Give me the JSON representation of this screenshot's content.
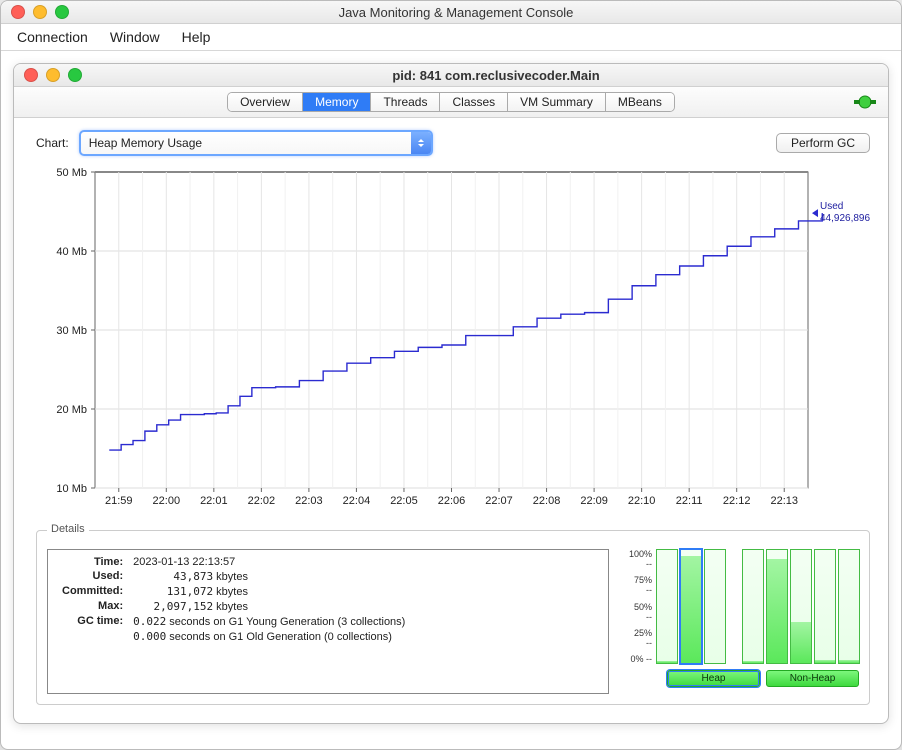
{
  "app_title": "Java Monitoring & Management Console",
  "menubar": [
    "Connection",
    "Window",
    "Help"
  ],
  "inner_title": "pid: 841 com.reclusivecoder.Main",
  "tabs": [
    "Overview",
    "Memory",
    "Threads",
    "Classes",
    "VM Summary",
    "MBeans"
  ],
  "active_tab": "Memory",
  "chart_label": "Chart:",
  "chart_select": "Heap Memory Usage",
  "perform_gc": "Perform GC",
  "used_legend_label": "Used",
  "used_legend_value": "44,926,896",
  "details_legend": "Details",
  "details": {
    "time_label": "Time:",
    "time_value": "2023-01-13 22:13:57",
    "used_label": "Used:",
    "used_value": "43,873",
    "used_unit": "kbytes",
    "committed_label": "Committed:",
    "committed_value": "131,072",
    "committed_unit": "kbytes",
    "max_label": "Max:",
    "max_value": "2,097,152",
    "max_unit": "kbytes",
    "gc_label": "GC time:",
    "gc_line1_num": "0.022",
    "gc_line1_rest": "seconds on G1 Young Generation (3 collections)",
    "gc_line2_num": "0.000",
    "gc_line2_rest": "seconds on G1 Old Generation (0 collections)"
  },
  "bar_pcts": [
    "100% --",
    "75% --",
    "50% --",
    "25% --",
    "0% --"
  ],
  "heap_btn": "Heap",
  "nonheap_btn": "Non-Heap",
  "chart_data": {
    "type": "line",
    "title": "Heap Memory Usage",
    "xlabel": "",
    "ylabel": "Mb",
    "ylim": [
      10,
      50
    ],
    "y_ticks": [
      10,
      20,
      30,
      40,
      50
    ],
    "y_tick_labels": [
      "10 Mb",
      "20 Mb",
      "30 Mb",
      "40 Mb",
      "50 Mb"
    ],
    "x_ticks": [
      "21:59",
      "22:00",
      "22:01",
      "22:02",
      "22:03",
      "22:04",
      "22:05",
      "22:06",
      "22:07",
      "22:08",
      "22:09",
      "22:10",
      "22:11",
      "22:12",
      "22:13"
    ],
    "series": [
      {
        "name": "Used",
        "color": "#2b2bd0",
        "x": [
          0,
          0.25,
          0.5,
          0.75,
          1,
          1.25,
          1.5,
          1.75,
          2,
          2.25,
          2.5,
          2.75,
          3,
          3.5,
          4,
          4.5,
          5,
          5.5,
          6,
          6.5,
          7,
          7.5,
          8,
          8.5,
          9,
          9.5,
          10,
          10.5,
          11,
          11.5,
          12,
          12.5,
          13,
          13.5,
          14,
          14.5,
          15
        ],
        "values": [
          14.8,
          15.5,
          16.0,
          17.2,
          18.0,
          18.6,
          19.3,
          19.3,
          19.4,
          19.5,
          20.4,
          21.6,
          22.7,
          22.8,
          23.6,
          24.8,
          25.8,
          26.5,
          27.3,
          27.8,
          28.1,
          29.3,
          29.3,
          30.4,
          31.5,
          32.0,
          32.2,
          33.9,
          35.6,
          37.0,
          38.1,
          39.4,
          40.6,
          41.8,
          42.8,
          43.8,
          44.8
        ]
      }
    ]
  },
  "heap_bars": [
    {
      "fill": 2
    },
    {
      "fill": 95
    },
    {
      "fill": 0
    }
  ],
  "nonheap_bars": [
    {
      "fill": 2
    },
    {
      "fill": 92
    },
    {
      "fill": 36
    },
    {
      "fill": 3
    },
    {
      "fill": 3
    }
  ]
}
